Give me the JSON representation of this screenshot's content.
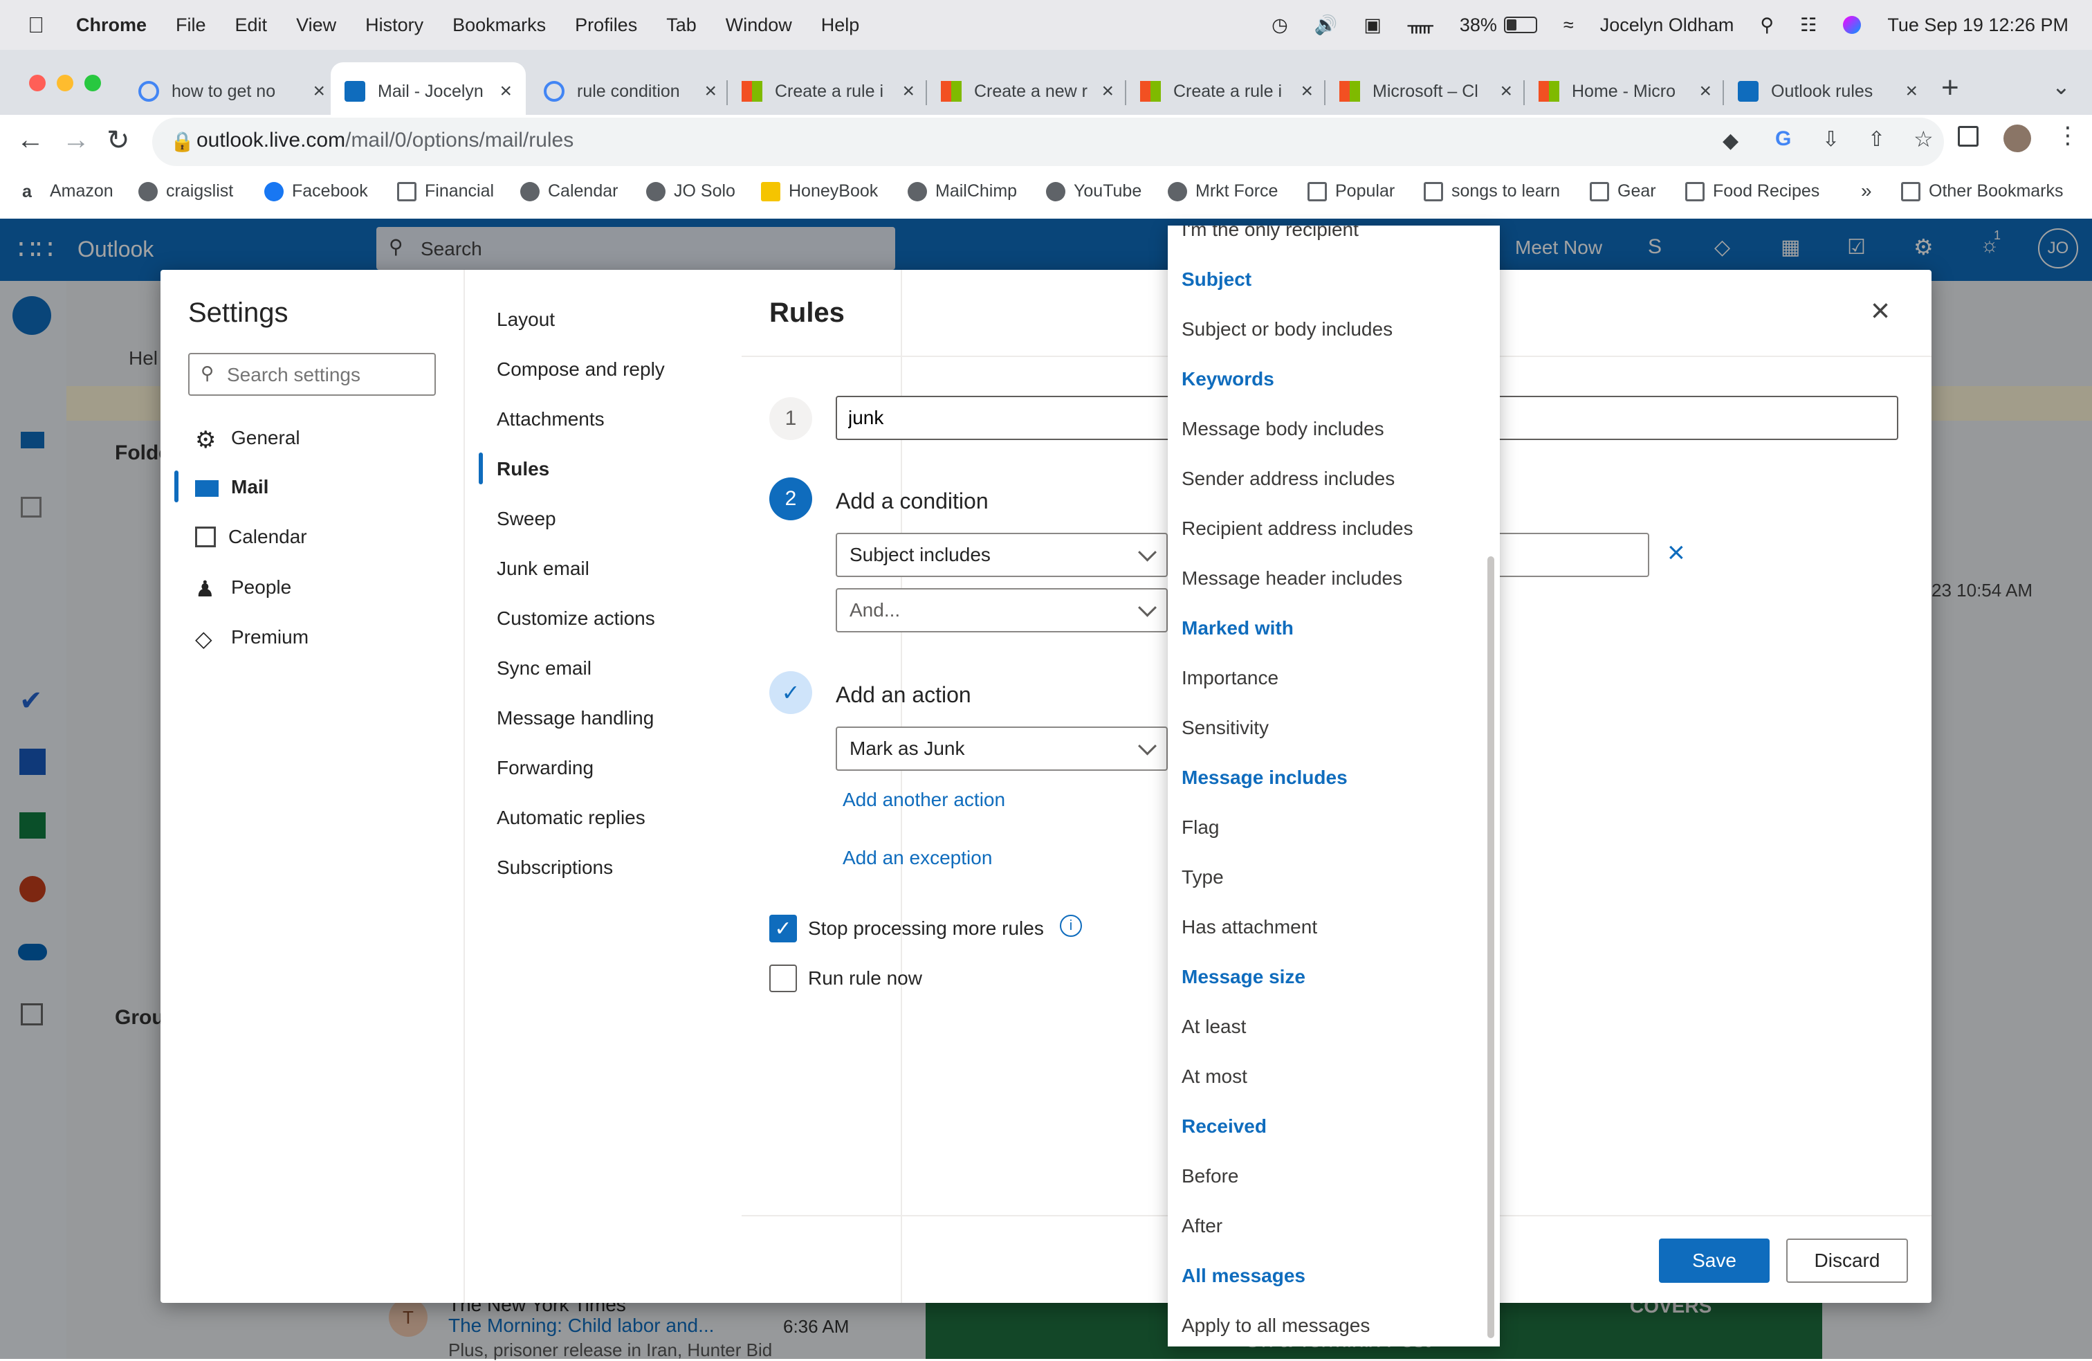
{
  "mac": {
    "app": "Chrome",
    "menus": [
      "File",
      "Edit",
      "View",
      "History",
      "Bookmarks",
      "Profiles",
      "Tab",
      "Window",
      "Help"
    ],
    "battery": "38%",
    "user": "Jocelyn Oldham",
    "datetime": "Tue Sep 19  12:26 PM"
  },
  "tabs": [
    {
      "label": "how to get no"
    },
    {
      "label": "Mail - Jocelyn"
    },
    {
      "label": "rule condition"
    },
    {
      "label": "Create a rule i"
    },
    {
      "label": "Create a new r"
    },
    {
      "label": "Create a rule i"
    },
    {
      "label": "Microsoft – Cl"
    },
    {
      "label": "Home - Micro"
    },
    {
      "label": "Outlook rules"
    }
  ],
  "address": {
    "domain": "outlook.live.com",
    "path": "/mail/0/options/mail/rules"
  },
  "bookmarks": [
    "Amazon",
    "craigslist",
    "Facebook",
    "Financial",
    "Calendar",
    "JO Solo",
    "HoneyBook",
    "MailChimp",
    "YouTube",
    "Mrkt Force",
    "Popular",
    "songs to learn",
    "Gear",
    "Food Recipes"
  ],
  "bookmarks_more": "»",
  "bookmarks_other": "Other Bookmarks",
  "outlook": {
    "brand": "Outlook",
    "search_placeholder": "Search",
    "meet_now": "Meet Now",
    "avatar": "JO",
    "badge": "1",
    "bg_help": "Hel",
    "bg_folders": "Folde",
    "bg_groups": "Grou",
    "bg_time_1": "23 10:54 AM",
    "bg_sender": "The New York Times",
    "bg_subject": "The Morning: Child labor and...",
    "bg_time_2": "6:36 AM",
    "bg_preview": "Plus, prisoner release in Iran, Hunter Bid",
    "bg_ad": "COVERS",
    "bg_ad_sub": "On a Terminix Pest",
    "bg_avatar": "T"
  },
  "settings": {
    "title": "Settings",
    "search_placeholder": "Search settings",
    "nav": [
      "General",
      "Mail",
      "Calendar",
      "People",
      "Premium"
    ],
    "subnav": [
      "Layout",
      "Compose and reply",
      "Attachments",
      "Rules",
      "Sweep",
      "Junk email",
      "Customize actions",
      "Sync email",
      "Message handling",
      "Forwarding",
      "Automatic replies",
      "Subscriptions"
    ]
  },
  "rules": {
    "title": "Rules",
    "step1": "1",
    "step2": "2",
    "rule_name": "junk",
    "add_condition": "Add a condition",
    "condition_selected": "Subject includes",
    "condition_and_placeholder": "And...",
    "add_action": "Add an action",
    "action_selected": "Mark as Junk",
    "add_another_action": "Add another action",
    "add_exception": "Add an exception",
    "stop_processing": "Stop processing more rules",
    "stop_processing_checked": true,
    "run_rule_now": "Run rule now",
    "run_rule_now_checked": false,
    "save": "Save",
    "discard": "Discard"
  },
  "dropdown": {
    "items": [
      {
        "text": "I'm the only recipient",
        "header": false
      },
      {
        "text": "Subject",
        "header": true
      },
      {
        "text": "Subject or body includes",
        "header": false
      },
      {
        "text": "Keywords",
        "header": true
      },
      {
        "text": "Message body includes",
        "header": false
      },
      {
        "text": "Sender address includes",
        "header": false
      },
      {
        "text": "Recipient address includes",
        "header": false
      },
      {
        "text": "Message header includes",
        "header": false
      },
      {
        "text": "Marked with",
        "header": true
      },
      {
        "text": "Importance",
        "header": false
      },
      {
        "text": "Sensitivity",
        "header": false
      },
      {
        "text": "Message includes",
        "header": true
      },
      {
        "text": "Flag",
        "header": false
      },
      {
        "text": "Type",
        "header": false
      },
      {
        "text": "Has attachment",
        "header": false
      },
      {
        "text": "Message size",
        "header": true
      },
      {
        "text": "At least",
        "header": false
      },
      {
        "text": "At most",
        "header": false
      },
      {
        "text": "Received",
        "header": true
      },
      {
        "text": "Before",
        "header": false
      },
      {
        "text": "After",
        "header": false
      },
      {
        "text": "All messages",
        "header": true
      },
      {
        "text": "Apply to all messages",
        "header": false
      }
    ]
  },
  "colors": {
    "accent": "#0f6cbd",
    "header": "#0f6cbd"
  }
}
